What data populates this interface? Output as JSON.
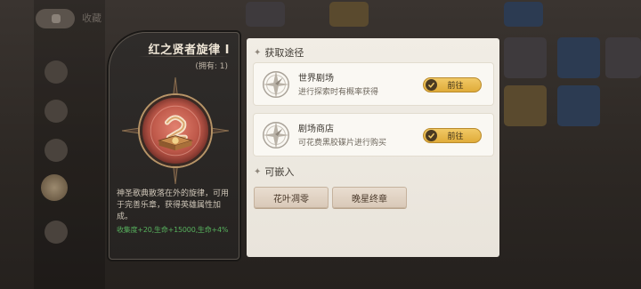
{
  "background": {
    "top_label": "收藏"
  },
  "item": {
    "title": "红之贤者旋律 I",
    "owned": "(拥有: 1)",
    "description": "神圣歌典散落在外的旋律，可用于完善乐章，获得英雄属性加成。",
    "stats": "收集度+20,生命+15000,生命+4%"
  },
  "acquire": {
    "title": "获取途径",
    "sources": [
      {
        "name": "世界剧场",
        "desc": "进行探索时有概率获得",
        "button": "前往",
        "icon": "compass-icon"
      },
      {
        "name": "剧场商店",
        "desc": "可花费黑胶碟片进行购买",
        "button": "前往",
        "icon": "compass-icon"
      }
    ]
  },
  "embed": {
    "title": "可嵌入",
    "items": [
      "花叶凋零",
      "晚星终章"
    ]
  },
  "colors": {
    "accent_gold": "#e0ac3a",
    "stat_green": "#57b05d",
    "panel_bg": "#f1ede5"
  }
}
